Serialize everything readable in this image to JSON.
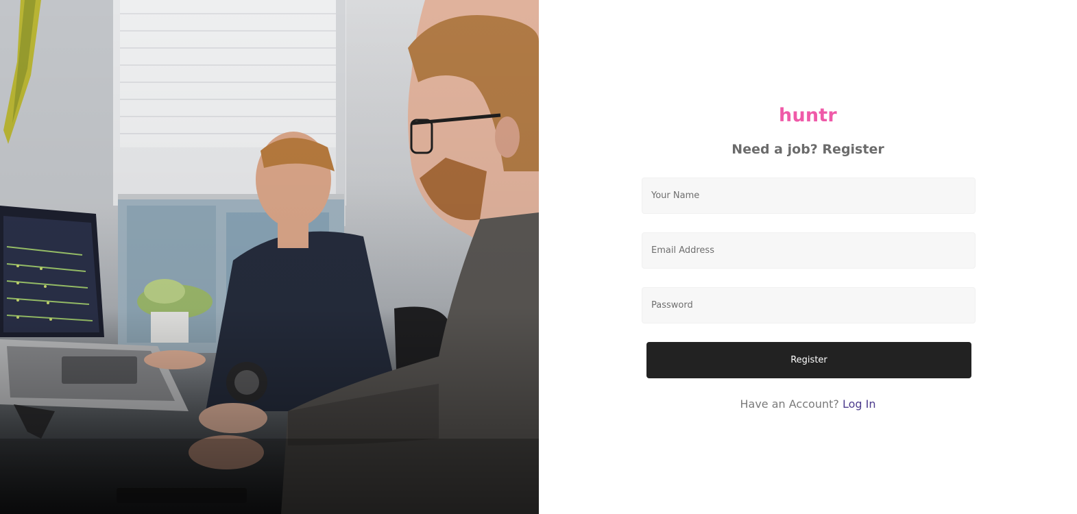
{
  "brand": {
    "name": "huntr",
    "color": "#ef5aa8"
  },
  "form": {
    "heading": "Need a job? Register",
    "fields": {
      "name": {
        "placeholder": "Your Name",
        "value": ""
      },
      "email": {
        "placeholder": "Email Address",
        "value": ""
      },
      "password": {
        "placeholder": "Password",
        "value": ""
      }
    },
    "submit_label": "Register",
    "button_color": "#222222"
  },
  "footer": {
    "prompt": "Have an Account?",
    "link_label": "Log In",
    "link_color": "#4b3a8c"
  }
}
